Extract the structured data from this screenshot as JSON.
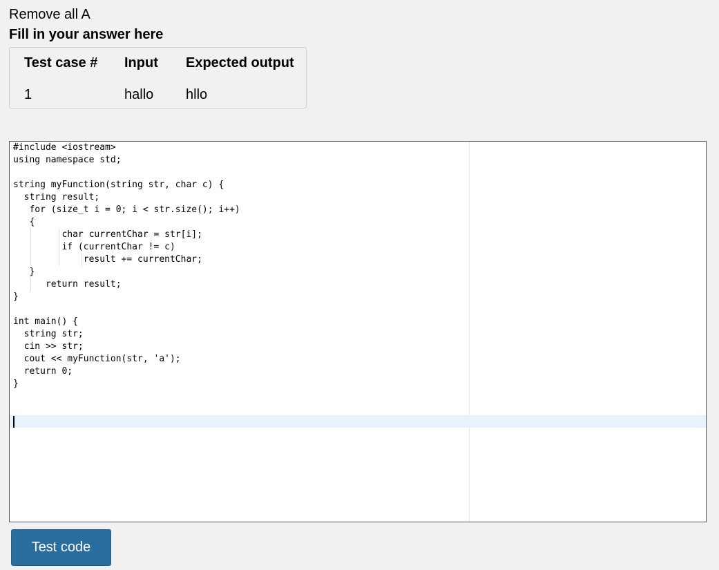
{
  "question": {
    "title": "Remove all A",
    "answer_heading": "Fill in your answer here"
  },
  "test_cases": {
    "headers": [
      "Test case #",
      "Input",
      "Expected output"
    ],
    "rows": [
      {
        "number": "1",
        "input": "hallo",
        "expected": "hllo"
      }
    ]
  },
  "editor": {
    "language": "cpp",
    "lines": [
      "#include <iostream>",
      "using namespace std;",
      "",
      "string myFunction(string str, char c) {",
      "  string result;",
      "   for (size_t i = 0; i < str.size(); i++)",
      "   {",
      "         char currentChar = str[i];",
      "         if (currentChar != c)",
      "             result += currentChar;",
      "   }",
      "      return result;",
      "}",
      "",
      "int main() {",
      "  string str;",
      "  cin >> str;",
      "  cout << myFunction(str, 'a');",
      "  return 0;",
      "}",
      "",
      "",
      ""
    ]
  },
  "actions": {
    "test_code_label": "Test code"
  }
}
